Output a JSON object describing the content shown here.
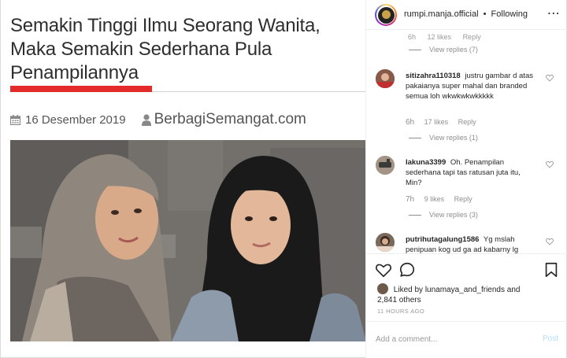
{
  "article": {
    "headline_line1": "Semakin Tinggi Ilmu Seorang Wanita,",
    "headline_line2": "Maka Semakin Sederhana Pula",
    "headline_line3": "Penampilannya",
    "date": "16 Desember 2019",
    "site": "BerbagiSemangat.com",
    "icons": [
      "calendar-icon",
      "user-icon"
    ],
    "accent_color": "#e32b2b"
  },
  "header": {
    "username": "rumpi.manja.official",
    "separator": "•",
    "follow_status": "Following",
    "more_icon": "⋯"
  },
  "comments": {
    "top_cut": {
      "time": "6h",
      "likes": "12 likes",
      "reply": "Reply"
    },
    "top_view_replies": "View replies (7)",
    "items": [
      {
        "username": "sitizahra110318",
        "text": "justru gambar d atas pakaianya super mahal dan branded semua loh wkwkwkwkkkkk",
        "time": "6h",
        "likes": "17 likes",
        "reply": "Reply",
        "view_replies": "View replies (1)"
      },
      {
        "username": "lakuna3399",
        "text": "Oh. Penampilan sederhana tapi tas ratusan juta itu, Min?",
        "time": "7h",
        "likes": "9 likes",
        "reply": "Reply",
        "view_replies": "View replies (3)"
      },
      {
        "username": "putrihutagalung1586",
        "text": "Yg mslah penipuan kog ud ga ad kabarny lg",
        "time": "",
        "likes": "",
        "reply": ""
      }
    ]
  },
  "actions": {
    "liked_by_prefix": "Liked by",
    "liked_by_user": "lunamaya_and_friends",
    "liked_by_and": "and",
    "others_count": "2,841 others",
    "time_ago": "11 HOURS AGO"
  },
  "composer": {
    "placeholder": "Add a comment...",
    "post_label": "Post"
  },
  "colors": {
    "link_blue": "#b2dffc",
    "muted_text": "#8e8e8e"
  }
}
